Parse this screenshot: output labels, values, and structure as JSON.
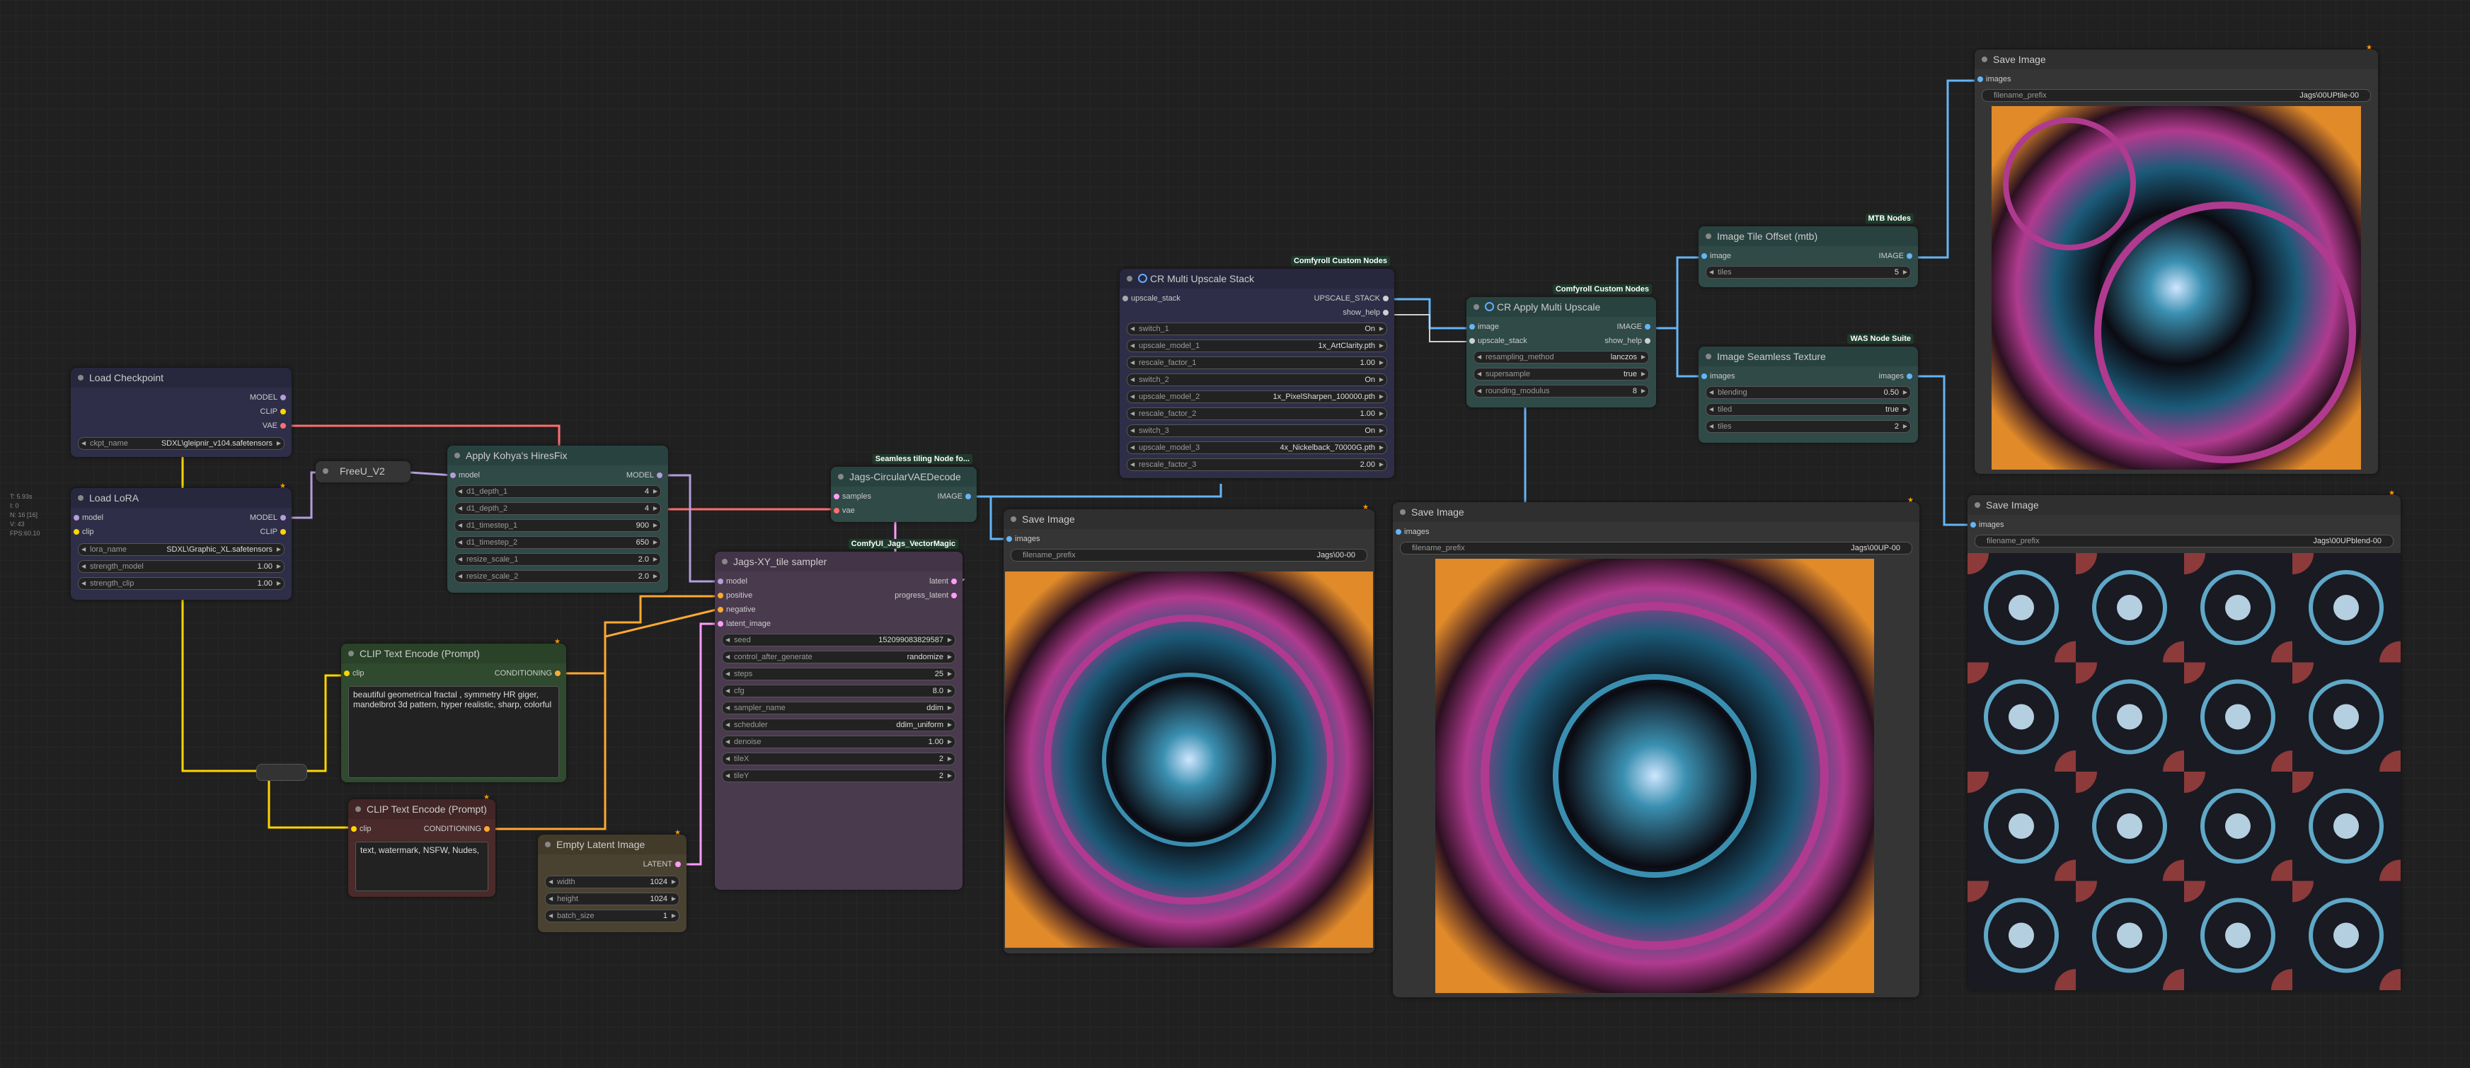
{
  "stats": [
    "T: 5.93s",
    "I: 0",
    "N: 16 [16]",
    "V: 43",
    "FPS:60.10"
  ],
  "colors": {
    "wire_model": "#b39ddb",
    "wire_clip": "#ffd500",
    "wire_vae": "#ff6e6e",
    "wire_image": "#64b5f6",
    "wire_latent": "#ff9cf9",
    "wire_cond": "#ffa931"
  },
  "nodes": {
    "load_checkpoint": {
      "title": "Load Checkpoint",
      "outputs": [
        "MODEL",
        "CLIP",
        "VAE"
      ],
      "widget_label": "ckpt_name",
      "widget_value": "SDXL\\gleipnir_v104.safetensors"
    },
    "load_lora": {
      "title": "Load LoRA",
      "inputs": [
        "model",
        "clip"
      ],
      "outputs": [
        "MODEL",
        "CLIP"
      ],
      "widgets": [
        {
          "label": "lora_name",
          "value": "SDXL\\Graphic_XL.safetensors"
        },
        {
          "label": "strength_model",
          "value": "1.00"
        },
        {
          "label": "strength_clip",
          "value": "1.00"
        }
      ]
    },
    "freeu": {
      "title": "FreeU_V2"
    },
    "hiresfix": {
      "title": "Apply Kohya's HiresFix",
      "inputs": [
        "model"
      ],
      "outputs": [
        "MODEL"
      ],
      "widgets": [
        {
          "label": "d1_depth_1",
          "value": "4"
        },
        {
          "label": "d1_depth_2",
          "value": "4"
        },
        {
          "label": "d1_timestep_1",
          "value": "900"
        },
        {
          "label": "d1_timestep_2",
          "value": "650"
        },
        {
          "label": "resize_scale_1",
          "value": "2.0"
        },
        {
          "label": "resize_scale_2",
          "value": "2.0"
        }
      ]
    },
    "vae_decode": {
      "title": "Jags-CircularVAEDecode",
      "badge": "Seamless tiling Node fo...",
      "inputs": [
        "samples",
        "vae"
      ],
      "outputs": [
        "IMAGE"
      ]
    },
    "xy_sampler": {
      "title": "Jags-XY_tile sampler",
      "badge": "ComfyUI_Jags_VectorMagic",
      "inputs": [
        "model",
        "positive",
        "negative",
        "latent_image"
      ],
      "outputs": [
        "latent",
        "progress_latent"
      ],
      "widgets": [
        {
          "label": "seed",
          "value": "152099083829587"
        },
        {
          "label": "control_after_generate",
          "value": "randomize"
        },
        {
          "label": "steps",
          "value": "25"
        },
        {
          "label": "cfg",
          "value": "8.0"
        },
        {
          "label": "sampler_name",
          "value": "ddim"
        },
        {
          "label": "scheduler",
          "value": "ddim_uniform"
        },
        {
          "label": "denoise",
          "value": "1.00"
        },
        {
          "label": "tileX",
          "value": "2"
        },
        {
          "label": "tileY",
          "value": "2"
        }
      ]
    },
    "clip_pos": {
      "title": "CLIP Text Encode (Prompt)",
      "inputs": [
        "clip"
      ],
      "outputs": [
        "CONDITIONING"
      ],
      "text": "beautiful geometrical fractal , symmetry HR giger, mandelbrot 3d pattern, hyper realistic, sharp, colorful"
    },
    "clip_neg": {
      "title": "CLIP Text Encode (Prompt)",
      "inputs": [
        "clip"
      ],
      "outputs": [
        "CONDITIONING"
      ],
      "text": "text, watermark, NSFW, Nudes,"
    },
    "empty_latent": {
      "title": "Empty Latent Image",
      "outputs": [
        "LATENT"
      ],
      "widgets": [
        {
          "label": "width",
          "value": "1024"
        },
        {
          "label": "height",
          "value": "1024"
        },
        {
          "label": "batch_size",
          "value": "1"
        }
      ]
    },
    "cr_stack": {
      "title": "CR Multi Upscale Stack",
      "badge": "Comfyroll Custom Nodes",
      "inputs": [
        "upscale_stack"
      ],
      "outputs": [
        "UPSCALE_STACK",
        "show_help"
      ],
      "widgets": [
        {
          "label": "switch_1",
          "value": "On"
        },
        {
          "label": "upscale_model_1",
          "value": "1x_ArtClarity.pth"
        },
        {
          "label": "rescale_factor_1",
          "value": "1.00"
        },
        {
          "label": "switch_2",
          "value": "On"
        },
        {
          "label": "upscale_model_2",
          "value": "1x_PixelSharpen_100000.pth"
        },
        {
          "label": "rescale_factor_2",
          "value": "1.00"
        },
        {
          "label": "switch_3",
          "value": "On"
        },
        {
          "label": "upscale_model_3",
          "value": "4x_Nickelback_70000G.pth"
        },
        {
          "label": "rescale_factor_3",
          "value": "2.00"
        }
      ]
    },
    "cr_apply": {
      "title": "CR Apply Multi Upscale",
      "badge": "Comfyroll Custom Nodes",
      "inputs": [
        "image",
        "upscale_stack"
      ],
      "outputs": [
        "IMAGE",
        "show_help"
      ],
      "widgets": [
        {
          "label": "resampling_method",
          "value": "lanczos"
        },
        {
          "label": "supersample",
          "value": "true"
        },
        {
          "label": "rounding_modulus",
          "value": "8"
        }
      ]
    },
    "tile_offset": {
      "title": "Image Tile Offset (mtb)",
      "badge": "MTB Nodes",
      "inputs": [
        "image"
      ],
      "outputs": [
        "IMAGE"
      ],
      "widgets": [
        {
          "label": "tiles",
          "value": "5"
        }
      ]
    },
    "seamless": {
      "title": "Image Seamless Texture",
      "badge": "WAS Node Suite",
      "inputs": [
        "images"
      ],
      "outputs": [
        "images"
      ],
      "widgets": [
        {
          "label": "blending",
          "value": "0.50"
        },
        {
          "label": "tiled",
          "value": "true"
        },
        {
          "label": "tiles",
          "value": "2"
        }
      ]
    },
    "save1": {
      "title": "Save Image",
      "inputs": [
        "images"
      ],
      "prefix_label": "filename_prefix",
      "prefix_value": "Jags\\00-00"
    },
    "save2": {
      "title": "Save Image",
      "inputs": [
        "images"
      ],
      "prefix_label": "filename_prefix",
      "prefix_value": "Jags\\00UP-00"
    },
    "save3": {
      "title": "Save Image",
      "inputs": [
        "images"
      ],
      "prefix_label": "filename_prefix",
      "prefix_value": "Jags\\00UPtile-00"
    },
    "save4": {
      "title": "Save Image",
      "inputs": [
        "images"
      ],
      "prefix_label": "filename_prefix",
      "prefix_value": "Jags\\00UPblend-00"
    }
  }
}
